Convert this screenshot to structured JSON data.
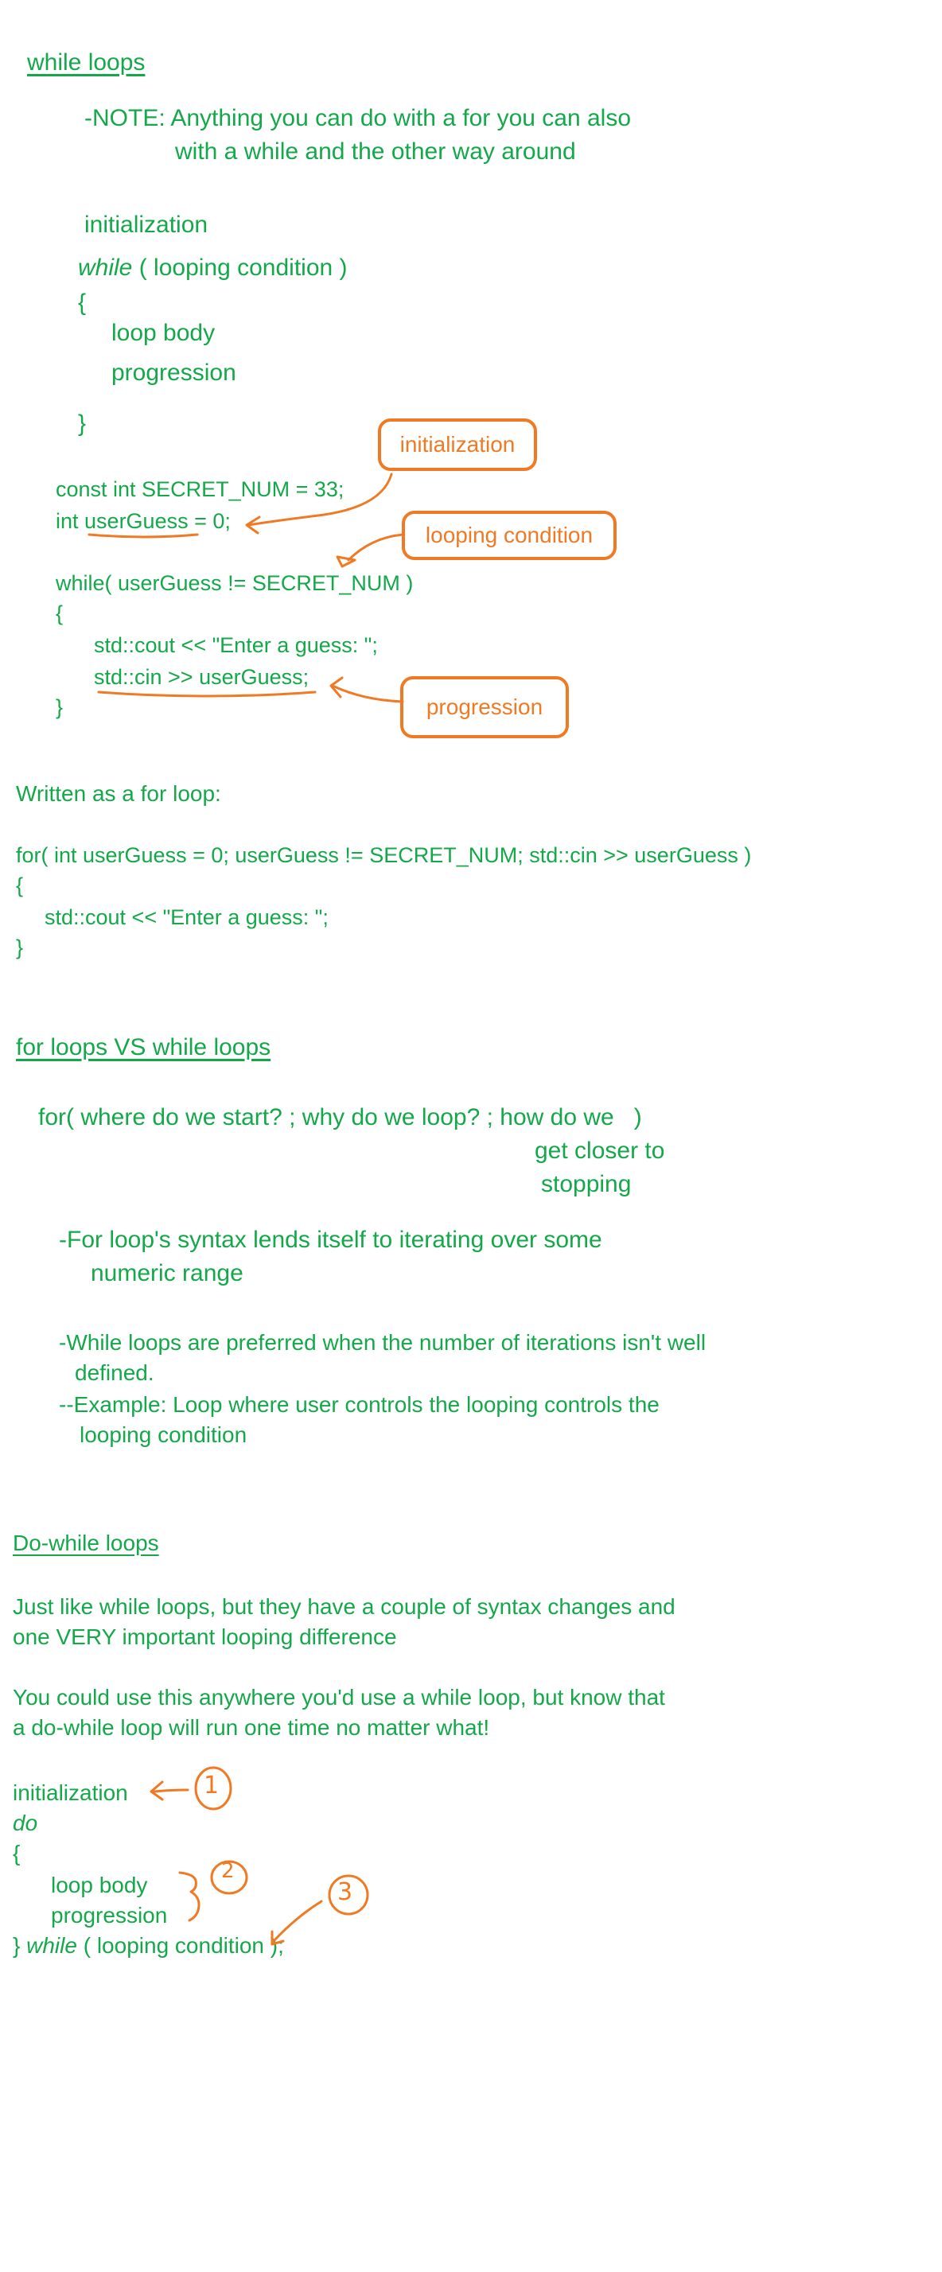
{
  "section1": {
    "heading": "while loops",
    "note_line1": "-NOTE: Anything you can do with a for you can also",
    "note_line2": "with a while and the other way around",
    "syntax": {
      "initialization": "initialization",
      "while_keyword": "while",
      "condition": " ( looping condition )",
      "open_brace": "{",
      "loop_body": "loop body",
      "progression": "progression",
      "close_brace": "}"
    },
    "code": {
      "line1": "const int SECRET_NUM = 33;",
      "line2_prefix": "int ",
      "line2_var": "userGuess",
      "line2_suffix": " = 0;",
      "line3": "while( userGuess != SECRET_NUM )",
      "line4": "{",
      "line5": "std::cout << \"Enter a guess: \";",
      "line6": "std::cin >> userGuess;",
      "line7": "}"
    },
    "annotations": {
      "initialization": "initialization",
      "looping_condition": "looping condition",
      "progression": "progression"
    }
  },
  "section2": {
    "intro": "Written as a for loop:",
    "line1": "for( int userGuess = 0; userGuess != SECRET_NUM; std::cin >> userGuess )",
    "line2": "{",
    "line3": "std::cout << \"Enter a guess: \";",
    "line4": "}"
  },
  "section3": {
    "heading": "for loops VS while loops",
    "for_line": "for( where do we start? ; why do we loop? ; how do we   )",
    "for_cont1": "get closer to",
    "for_cont2": "stopping",
    "point1_line1": "-For loop's syntax lends itself to iterating over some",
    "point1_line2": "numeric range",
    "point2_line1": "-While loops are preferred when the number of iterations isn't well",
    "point2_line2": "defined.",
    "point3_line1": "--Example: Loop where user controls the looping controls the",
    "point3_line2": "looping condition"
  },
  "section4": {
    "heading": "Do-while loops",
    "para1_line1": "Just like while loops, but they have a couple of syntax changes and",
    "para1_line2": "one VERY important looping difference",
    "para2_line1": "You could use this anywhere you'd use a while loop, but know that",
    "para2_line2": "a do-while loop will run one time no matter what!",
    "syntax": {
      "initialization": "initialization",
      "do_keyword": "do",
      "open_brace": "{",
      "loop_body": "loop body",
      "progression": "progression",
      "close_prefix": "} ",
      "while_keyword": "while",
      "condition": " ( looping condition );"
    },
    "markers": {
      "one": "1",
      "two": "2",
      "three": "3"
    }
  },
  "colors": {
    "text_green": "#14a84a",
    "ink_orange": "#f07a24"
  }
}
